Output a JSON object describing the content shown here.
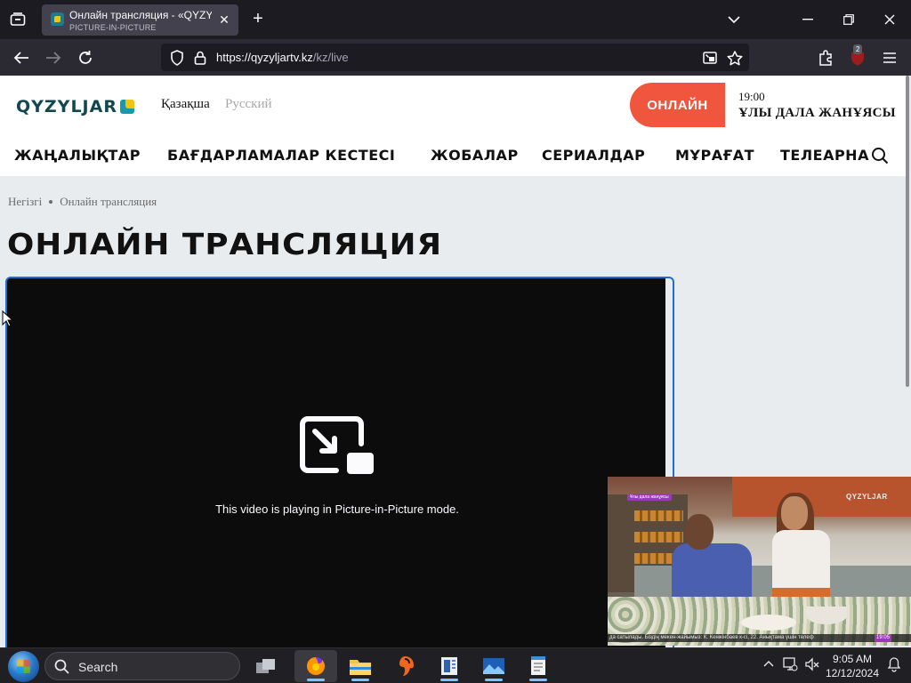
{
  "browser": {
    "tab": {
      "title": "Онлайн трансляция - «QYZYLJAR»",
      "subtitle": "PICTURE-IN-PICTURE"
    },
    "url": {
      "host": "https://qyzyljartv.kz",
      "path": "/kz/live"
    },
    "extension_badge": "2"
  },
  "site": {
    "logo_text": "QYZYLJAR",
    "lang_active": "Қазақша",
    "lang_other": "Русский",
    "live_button": "ОНЛАЙН",
    "now_time": "19:00",
    "now_title": "ҰЛЫ ДАЛА ЖАНҰЯСЫ",
    "menu": [
      "ЖАҢАЛЫҚТАР",
      "БАҒДАРЛАМАЛАР КЕСТЕСІ",
      "ЖОБАЛАР",
      "СЕРИАЛДАР",
      "МҰРАҒАТ",
      "ТЕЛЕАРНА"
    ],
    "breadcrumb": [
      "Негізгі",
      "Онлайн трансляция"
    ],
    "page_title": "ОНЛАЙН ТРАНСЛЯЦИЯ",
    "pip_message": "This video is playing in Picture-in-Picture mode."
  },
  "pip_window": {
    "channel_logo": "QYZYLJAR",
    "program_tag": "Ұлы дала жанұясы",
    "ticker": "да сатылады. Біздің мекен-жайымыз: К. Кенжінбаев к-сі, 22. Анықтама үшін телеф",
    "ticker_time": "19:05"
  },
  "taskbar": {
    "search_label": "Search",
    "time": "9:05 AM",
    "date": "12/12/2024"
  },
  "colors": {
    "accent_live": "#f0553d",
    "focus_border": "#1f6fd1",
    "logo": "#11474f"
  }
}
